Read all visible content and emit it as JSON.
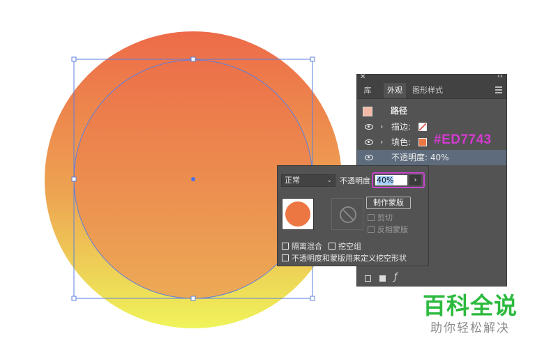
{
  "appearance_panel": {
    "tabs": [
      "库",
      "外观",
      "图形样式"
    ],
    "active_tab": "外观",
    "object_label": "路径",
    "rows": {
      "stroke": {
        "label": "描边:"
      },
      "fill": {
        "label": "填色:",
        "color": "#ED7743"
      },
      "opacity": {
        "label": "不透明度: 40%"
      }
    }
  },
  "annotation": {
    "fill_hex": "#ED7743"
  },
  "transparency_popup": {
    "blend_mode": "正常",
    "opacity_label": "不透明度",
    "opacity_value": "40%",
    "make_mask_label": "制作蒙版",
    "clip_label": "剪切",
    "invert_mask_label": "反相蒙版",
    "isolate_blending_label": "隔离混合",
    "knockout_group_label": "挖空组",
    "opacity_mask_knockout_label": "不透明度和蒙版用来定义挖空形状"
  },
  "artwork": {
    "gradient_top": "#ED6A48",
    "gradient_bottom": "#EFF45A",
    "selected_fill": "#ED7743",
    "selection_color": "#5b7fe0"
  },
  "watermark": {
    "title": "百科全说",
    "subtitle": "助你轻松解决"
  }
}
